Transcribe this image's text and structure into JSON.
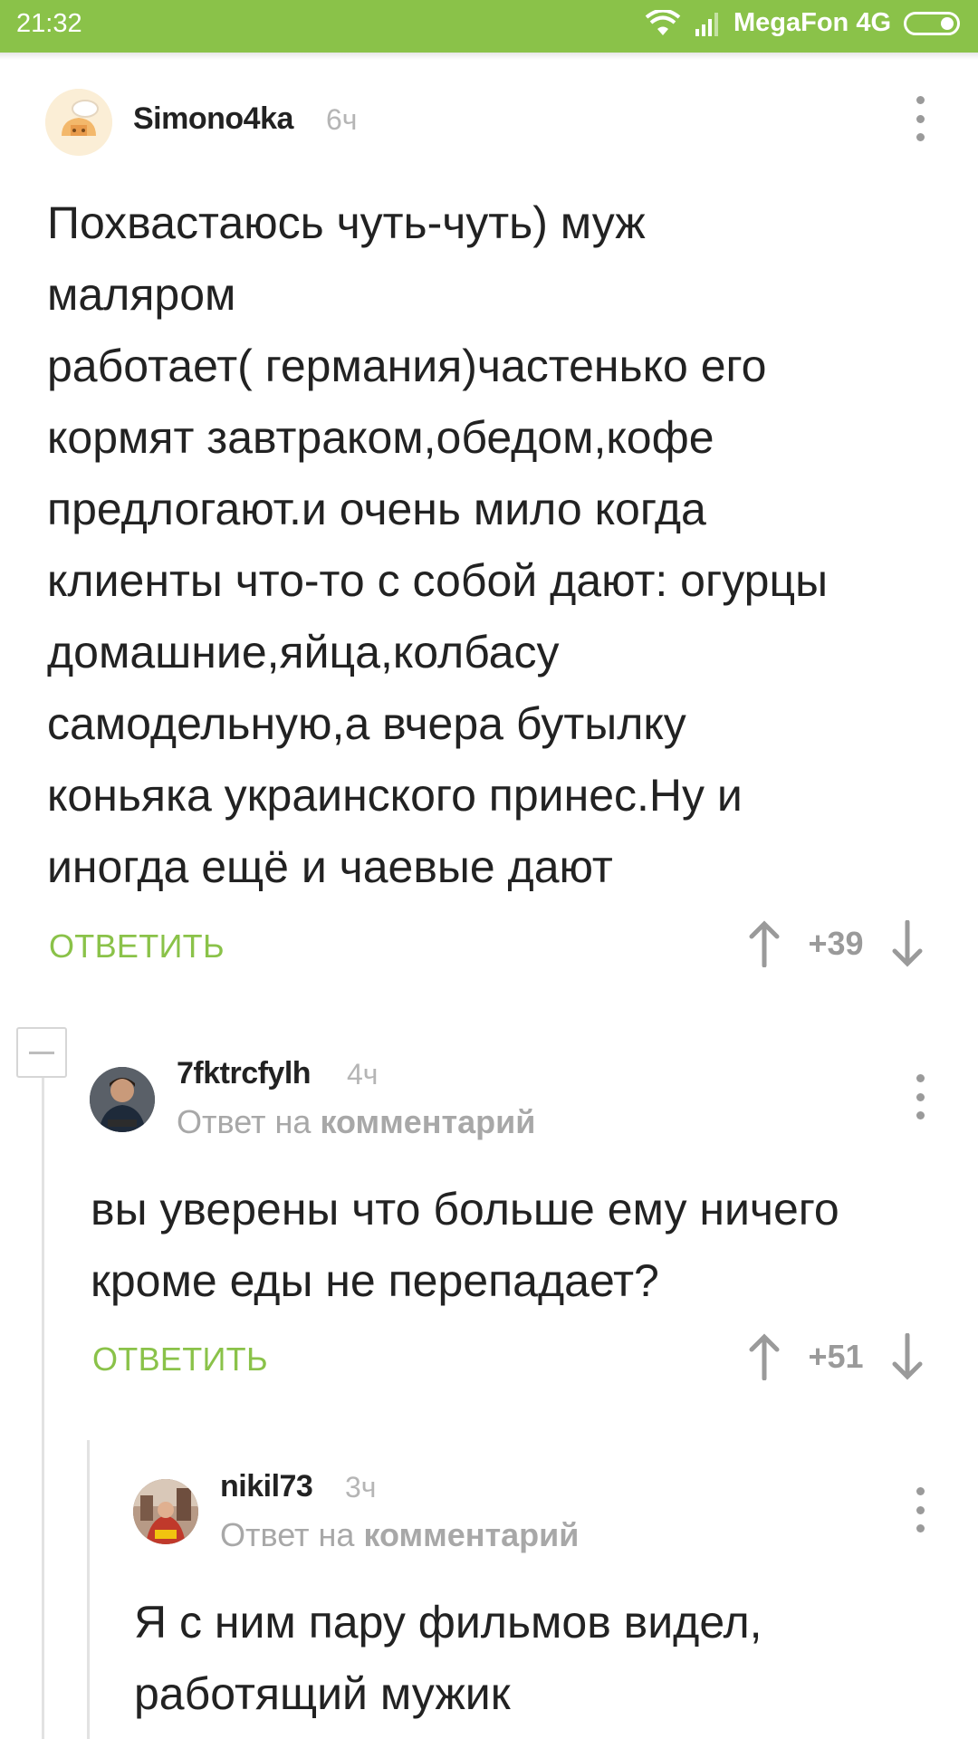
{
  "status_bar": {
    "time": "21:32",
    "carrier": "MegaFon 4G"
  },
  "comments": [
    {
      "username": "Simono4ka",
      "time": "6ч",
      "text": "Похвастаюсь чуть-чуть) муж\nмаляром\nработает( германия)частенько его\nкормят завтраком,обедом,кофе\nпредлогают.и очень мило когда\nклиенты что-то с собой дают: огурцы\nдомашние,яйца,колбасу\nсамодельную,а вчера бутылку\nконьяка украинского принес.Ну и\nиногда ещё и чаевые дают",
      "reply_label": "ОТВЕТИТЬ",
      "score": "+39"
    },
    {
      "username": "7fktrcfylh",
      "time": "4ч",
      "reply_prefix": "Ответ на",
      "reply_target": "комментарий",
      "text": "вы уверены что больше ему ничего\nкроме еды не перепадает?",
      "reply_label": "ОТВЕТИТЬ",
      "score": "+51"
    },
    {
      "username": "nikil73",
      "time": "3ч",
      "reply_prefix": "Ответ на",
      "reply_target": "комментарий",
      "text": "Я с ним пару фильмов видел,\nработящий мужик"
    }
  ],
  "colors": {
    "accent": "#8ac249",
    "muted": "#a8a8a8"
  },
  "icons": [
    "wifi-icon",
    "signal-icon",
    "battery-icon",
    "more-vert-icon",
    "upvote-arrow-icon",
    "downvote-arrow-icon",
    "collapse-minus-icon"
  ]
}
